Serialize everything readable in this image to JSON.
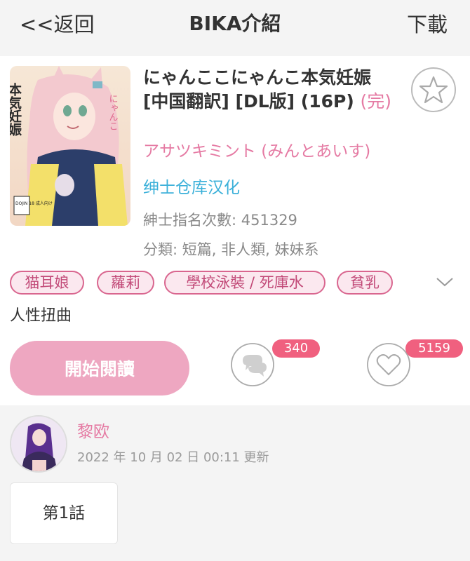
{
  "header": {
    "back_label": "<<返回",
    "title": "BIKA介紹",
    "download_label": "下載"
  },
  "comic": {
    "title": "にゃんここにゃんこ本気妊娠 [中国翻訳] [DL版] (16P)",
    "status": "(完)",
    "author": "アサツキミント (みんとあいす)",
    "translator": "绅士仓库汉化",
    "views_label": "紳士指名次數: 451329",
    "category_label": "分類: 短篇, 非人類, 妹妹系",
    "cover_text": {
      "title_vertical": "本気妊娠",
      "subtitle_vertical": "にゃんこ",
      "badge": "DOJIN 18 成人向け"
    }
  },
  "tags": [
    "猫耳娘",
    "蘿莉",
    "學校泳裝 / 死庫水",
    "貧乳"
  ],
  "extra_tag": "人性扭曲",
  "actions": {
    "read_label": "開始閱讀",
    "comment_count": "340",
    "like_count": "5159"
  },
  "uploader": {
    "name": "黎欧",
    "update_time": "2022 年 10 月 02 日  00:11 更新"
  },
  "chapters": [
    "第1話"
  ],
  "colors": {
    "pink": "#e57aa3",
    "blue": "#3bb0d9",
    "button_pink": "#eea7c1",
    "badge_red": "#f0607f"
  },
  "icons": [
    "star-icon",
    "chevron-down-icon",
    "comment-icon",
    "heart-icon"
  ]
}
